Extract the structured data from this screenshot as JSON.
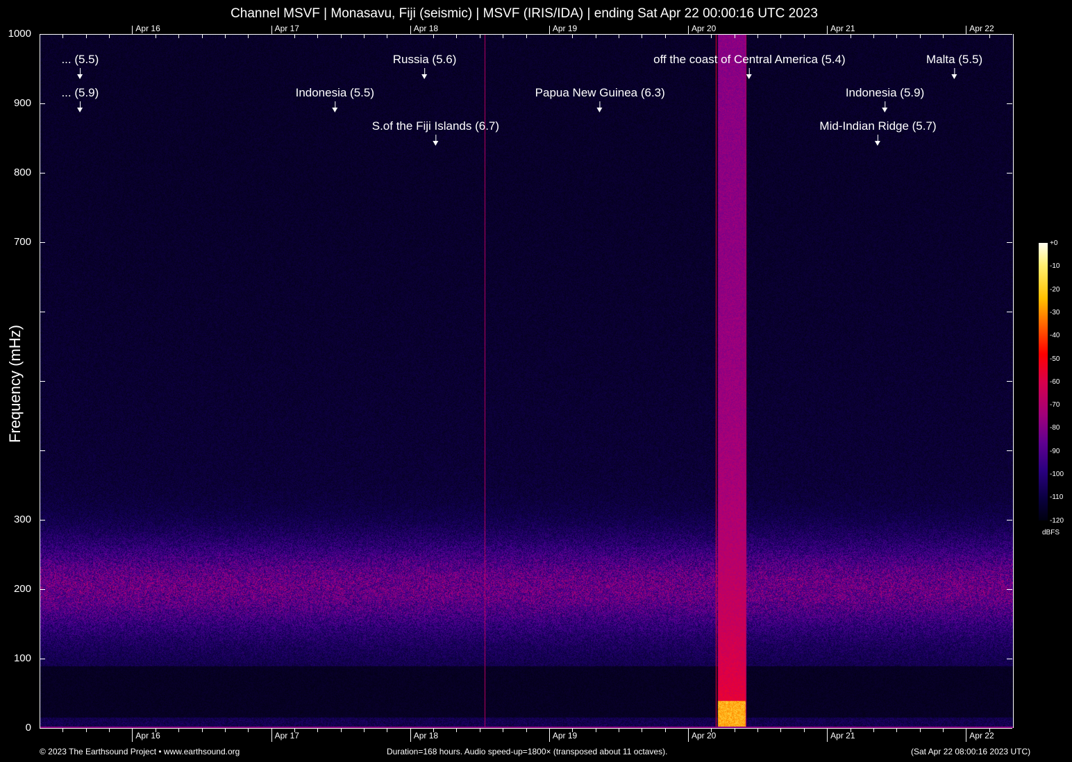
{
  "title": "Channel MSVF | Monasavu, Fiji (seismic) | MSVF (IRIS/IDA) | ending Sat Apr 22 00:00:16 UTC 2023",
  "chart_data": {
    "type": "heatmap",
    "title": "Channel MSVF | Monasavu, Fiji (seismic) | MSVF (IRIS/IDA) | ending Sat Apr 22 00:00:16 UTC 2023",
    "ylabel": "Frequency (mHz)",
    "xlabel": "",
    "ylim": [
      0,
      1000
    ],
    "xlim_hours": [
      0,
      168
    ],
    "y_ticks": [
      {
        "value": 0,
        "label": "0"
      },
      {
        "value": 100,
        "label": "100"
      },
      {
        "value": 200,
        "label": "200"
      },
      {
        "value": 300,
        "label": "300"
      },
      {
        "value": 400,
        "label": ""
      },
      {
        "value": 500,
        "label": ""
      },
      {
        "value": 600,
        "label": ""
      },
      {
        "value": 700,
        "label": "700"
      },
      {
        "value": 800,
        "label": "800"
      },
      {
        "value": 900,
        "label": "900"
      },
      {
        "value": 1000,
        "label": "1000"
      }
    ],
    "x_ticks": [
      {
        "hour": 16,
        "label": "Apr 16"
      },
      {
        "hour": 40,
        "label": "Apr 17"
      },
      {
        "hour": 64,
        "label": "Apr 18"
      },
      {
        "hour": 88,
        "label": "Apr 19"
      },
      {
        "hour": 112,
        "label": "Apr 20"
      },
      {
        "hour": 136,
        "label": "Apr 21"
      },
      {
        "hour": 160,
        "label": "Apr 22"
      }
    ],
    "events": [
      {
        "label": "... (5.5)",
        "hour": 7.0,
        "tier": 1
      },
      {
        "label": "... (5.9)",
        "hour": 7.0,
        "tier": 2
      },
      {
        "label": "Indonesia (5.5)",
        "hour": 51.0,
        "tier": 2
      },
      {
        "label": "S.of the Fiji Islands (6.7)",
        "hour": 68.4,
        "tier": 3
      },
      {
        "label": "Russia (5.6)",
        "hour": 66.5,
        "tier": 1
      },
      {
        "label": "Papua New Guinea (6.3)",
        "hour": 96.8,
        "tier": 2
      },
      {
        "label": "off the coast of Central America (5.4)",
        "hour": 122.6,
        "tier": 1
      },
      {
        "label": "Indonesia (5.9)",
        "hour": 146.0,
        "tier": 2
      },
      {
        "label": "Mid-Indian Ridge (5.7)",
        "hour": 144.8,
        "tier": 3
      },
      {
        "label": "Malta (5.5)",
        "hour": 158.0,
        "tier": 1
      }
    ],
    "colorbar": {
      "unit": "dBFS",
      "ticks": [
        "+0",
        "-10",
        "-20",
        "-30",
        "-40",
        "-50",
        "-60",
        "-70",
        "-80",
        "-90",
        "-100",
        "-110",
        "-120"
      ],
      "range": [
        -120,
        0
      ]
    }
  },
  "footer": {
    "left": "© 2023 The Earthsound Project • www.earthsound.org",
    "center": "Duration=168 hours. Audio speed-up=1800× (transposed about 11 octaves).",
    "right": "(Sat Apr 22 08:00:16 2023 UTC)"
  }
}
